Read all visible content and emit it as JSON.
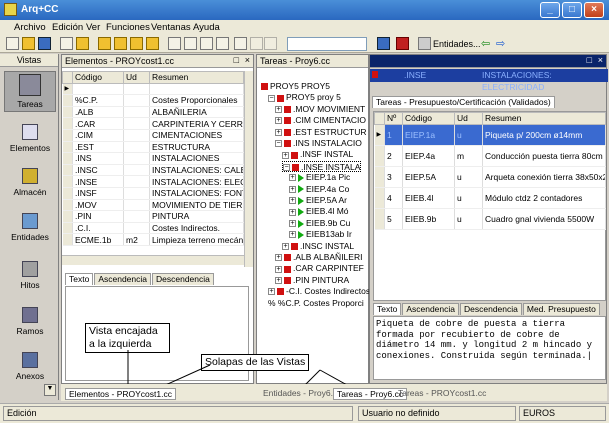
{
  "window": {
    "title": "Arq+CC",
    "btn_min": "_",
    "btn_max": "□",
    "btn_close": "×"
  },
  "menu": [
    "Archivo",
    "Edición",
    "Ver",
    "Funciones",
    "Ventanas",
    "Ayuda"
  ],
  "toolbar": {
    "entidades_label": "Entidades...",
    "nav_left": "⇦",
    "nav_right": "⇨"
  },
  "nav": {
    "header": "Vistas",
    "items": [
      "Tareas",
      "Elementos",
      "Almacén",
      "Entidades",
      "Hitos",
      "Ramos",
      "Anexos"
    ]
  },
  "elementos": {
    "title": "Elementos - PROYcost1.cc",
    "columns": [
      "Código",
      "Ud",
      "Resumen"
    ],
    "rows": [
      [
        "",
        "",
        ""
      ],
      [
        "%C.P.",
        "",
        "Costes Proporcionales"
      ],
      [
        ".ALB",
        "",
        "ALBAÑILERIA"
      ],
      [
        ".CAR",
        "",
        "CARPINTERIA Y CERRAJE"
      ],
      [
        ".CIM",
        "",
        "CIMENTACIONES"
      ],
      [
        ".EST",
        "",
        "ESTRUCTURA"
      ],
      [
        ".INS",
        "",
        "INSTALACIONES"
      ],
      [
        ".INSC",
        "",
        "INSTALACIONES: CALEFA"
      ],
      [
        ".INSE",
        "",
        "INSTALACIONES: ELECTF"
      ],
      [
        ".INSF",
        "",
        "INSTALACIONES: FONTAI"
      ],
      [
        ".MOV",
        "",
        "MOVIMIENTO DE TIERRA"
      ],
      [
        ".PIN",
        "",
        "PINTURA"
      ],
      [
        ".C.I.",
        "",
        "Costes Indirectos."
      ],
      [
        "ECME.1b",
        "m2",
        "Limpieza terreno mecánico"
      ]
    ],
    "tabs": [
      "Texto",
      "Ascendencia",
      "Descendencia"
    ]
  },
  "tareas": {
    "title": "Tareas - Proy6.cc",
    "tree": [
      "PROY5  PROY5",
      "PROY5  proy 5",
      ".MOV  MOVIMIENT",
      ".CIM  CIMENTACIO",
      ".EST  ESTRUCTUR",
      ".INS  INSTALACIO",
      ".INSF  INSTAL",
      ".INSE  INSTALA",
      "EIEP.1a  Pic",
      "EIEP.4a  Co",
      "EIEP.5A  Ar",
      "EIEB.4l  Mó",
      "EIEB.9b  Cu",
      "EIEB13ab  Ir",
      ".INSC  INSTAL",
      ".ALB  ALBAÑILERI",
      ".CAR  CARPINTEF",
      ".PIN  PINTURA",
      "-C.I.  Costes Indirectos",
      "%  %C.P.  Costes Proporci"
    ]
  },
  "presupuesto": {
    "top_code": ".INSE",
    "top_desc": "INSTALACIONES: ELECTRICIDAD",
    "title": "Tareas - Presupuesto/Certificación (Validados)",
    "columns": [
      "Nº",
      "Código",
      "Ud",
      "Resumen"
    ],
    "rows": [
      [
        "1",
        "EIEP.1a",
        "u",
        "Piqueta p/ 200cm ø14mm"
      ],
      [
        "2",
        "EIEP.4a",
        "m",
        "Conducción puesta tierra 80cm"
      ],
      [
        "3",
        "EIEP.5A",
        "u",
        "Arqueta conexión tierra 38x50x2"
      ],
      [
        "4",
        "EIEB.4l",
        "u",
        "Módulo ctdz 2 contadores"
      ],
      [
        "5",
        "EIEB.9b",
        "u",
        "Cuadro gnal vivienda 5500W"
      ]
    ],
    "tabs": [
      "Texto",
      "Ascendencia",
      "Descendencia",
      "Med. Presupuesto"
    ],
    "text": "Piqueta de cobre de puesta a tierra formada por recubierto de cobre de diámetro 14 mm. y longitud 2 m hincado y conexiones. Construida según terminada.|"
  },
  "callouts": {
    "left": "Vista encajada\na la izquierda",
    "tabs": "Solapas de las Vistas"
  },
  "bottom_tabs": {
    "left": "Elementos - PROYcost1.cc",
    "mid": "Entidades - Proy6.cc",
    "tareas": "Tareas - Proy6.cc",
    "tareas2": "Tareas - PROYcost1.cc"
  },
  "status": {
    "mode": "Edición",
    "user": "Usuario no definido",
    "currency": "EUROS"
  },
  "colors": {
    "selection": "#0a246a",
    "red": "#d01010",
    "green": "#1a1"
  }
}
